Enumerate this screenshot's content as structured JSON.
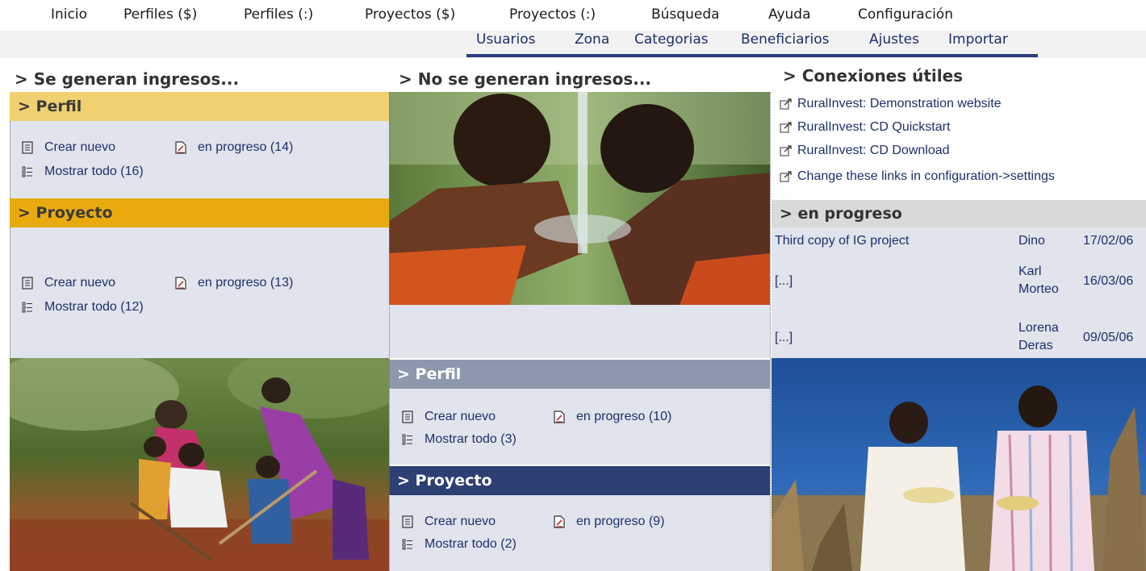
{
  "top_menu": [
    "Inicio",
    "Perfiles ($)",
    "Perfiles (:)",
    "Proyectos ($)",
    "Proyectos (:)",
    "Búsqueda",
    "Ayuda",
    "Configuración"
  ],
  "sub_menu": [
    "Usuarios",
    "Zona",
    "Categorias",
    "Beneficiarios",
    "Ajustes",
    "Importar"
  ],
  "col1": {
    "heading": "> Se generan ingresos...",
    "perfil": {
      "title": "> Perfil",
      "create": "Crear nuevo",
      "progress": "en progreso (14)",
      "show_all": "Mostrar todo (16)"
    },
    "proyecto": {
      "title": "> Proyecto",
      "create": "Crear nuevo",
      "progress": "en progreso (13)",
      "show_all": "Mostrar todo (12)"
    }
  },
  "col2": {
    "heading": "> No se generan ingresos...",
    "perfil": {
      "title": "> Perfil",
      "create": "Crear nuevo",
      "progress": "en progreso (10)",
      "show_all": "Mostrar todo (3)"
    },
    "proyecto": {
      "title": "> Proyecto",
      "create": "Crear nuevo",
      "progress": "en progreso (9)",
      "show_all": "Mostrar todo (2)"
    }
  },
  "col3": {
    "heading": "> Conexiones útiles",
    "links": [
      "RuralInvest: Demonstration website",
      "RuralInvest: CD Quickstart",
      "RuralInvest: CD Download",
      "Change these links in configuration->settings"
    ],
    "progress_title": "> en progreso",
    "progress_rows": [
      {
        "name": "Third copy of IG project",
        "user": "Dino",
        "date": "17/02/06"
      },
      {
        "name": "[...]",
        "user": "Karl Morteo",
        "date": "16/03/06"
      },
      {
        "name": "[...]",
        "user": "Lorena Deras",
        "date": "09/05/06"
      }
    ]
  },
  "colors": {
    "menu_accent": "#2c3e7a",
    "perfil_gold": "#f0d070",
    "proyecto_gold": "#e8aa0c",
    "perfil_grey": "#8e98ac",
    "proyecto_navy": "#2d3f73",
    "panel": "#e1e4ec"
  },
  "icons": {
    "create": "document-lines-icon",
    "progress": "document-edit-icon",
    "show_all": "list-icon",
    "link": "external-link-icon"
  }
}
